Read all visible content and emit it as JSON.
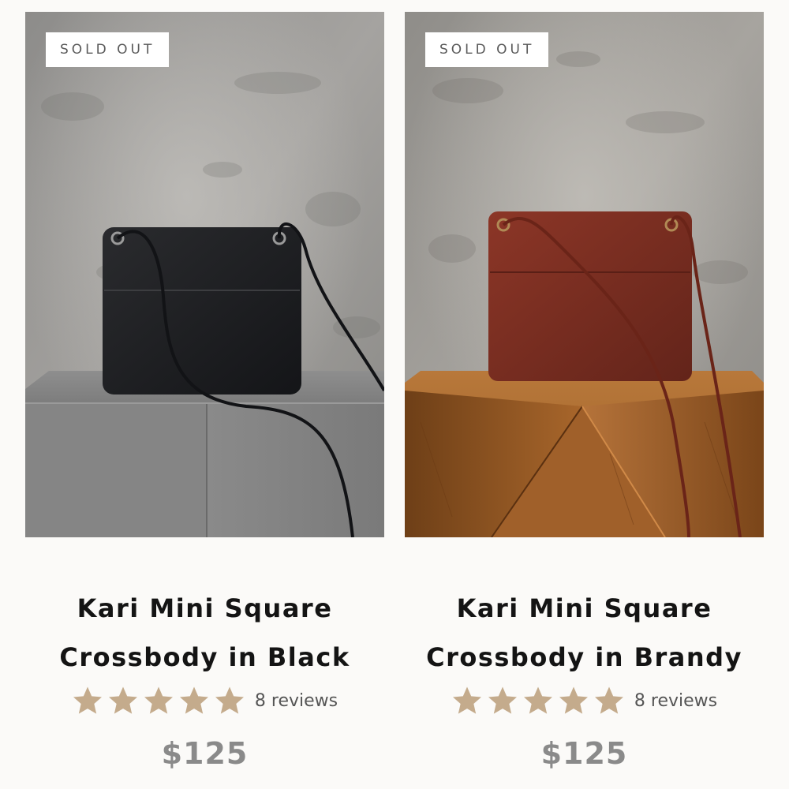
{
  "colors": {
    "background": "#fbfaf8",
    "star": "#c4ab8c",
    "price": "#8a8a8a",
    "title": "#141414",
    "badge_bg": "#ffffff",
    "badge_text": "#5a5a5a"
  },
  "products": [
    {
      "badge": "SOLD OUT",
      "title_line1": "Kari Mini Square",
      "title_line2": "Crossbody in Black",
      "rating": 5,
      "reviews": "8 reviews",
      "price": "$125",
      "bag_color": "#1d1e20",
      "pedestal": "gray-stone-cube"
    },
    {
      "badge": "SOLD OUT",
      "title_line1": "Kari Mini Square",
      "title_line2": "Crossbody in Brandy",
      "rating": 5,
      "reviews": "8 reviews",
      "price": "$125",
      "bag_color": "#7e2f22",
      "pedestal": "wooden-faceted-stump"
    }
  ]
}
